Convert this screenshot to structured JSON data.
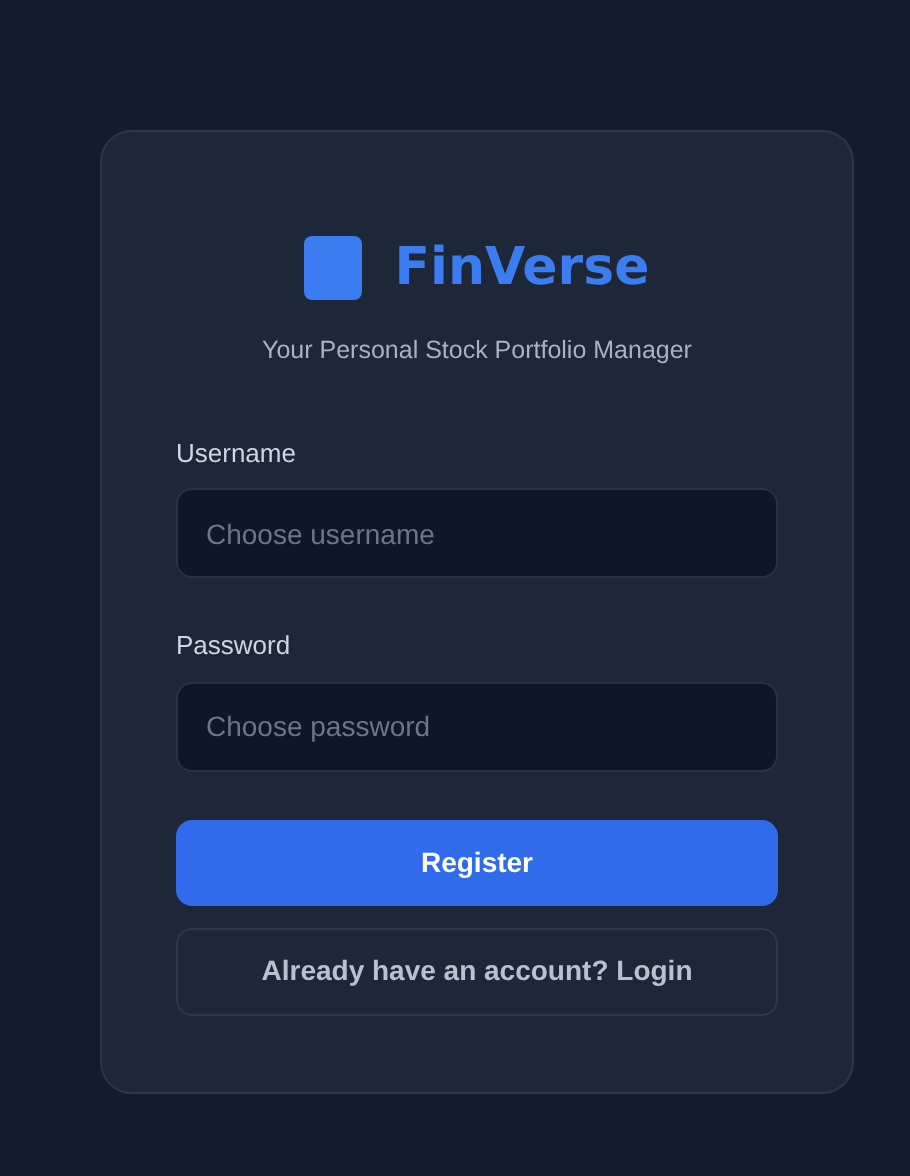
{
  "brand": {
    "name": "FinVerse",
    "tagline": "Your Personal Stock Portfolio Manager"
  },
  "fields": [
    {
      "label": "Username",
      "placeholder": "Choose username"
    },
    {
      "label": "Password",
      "placeholder": "Choose password"
    }
  ],
  "buttons": [
    {
      "label": "Register",
      "kind": "primary"
    },
    {
      "label": "Already have an account? Login",
      "kind": "secondary"
    }
  ]
}
